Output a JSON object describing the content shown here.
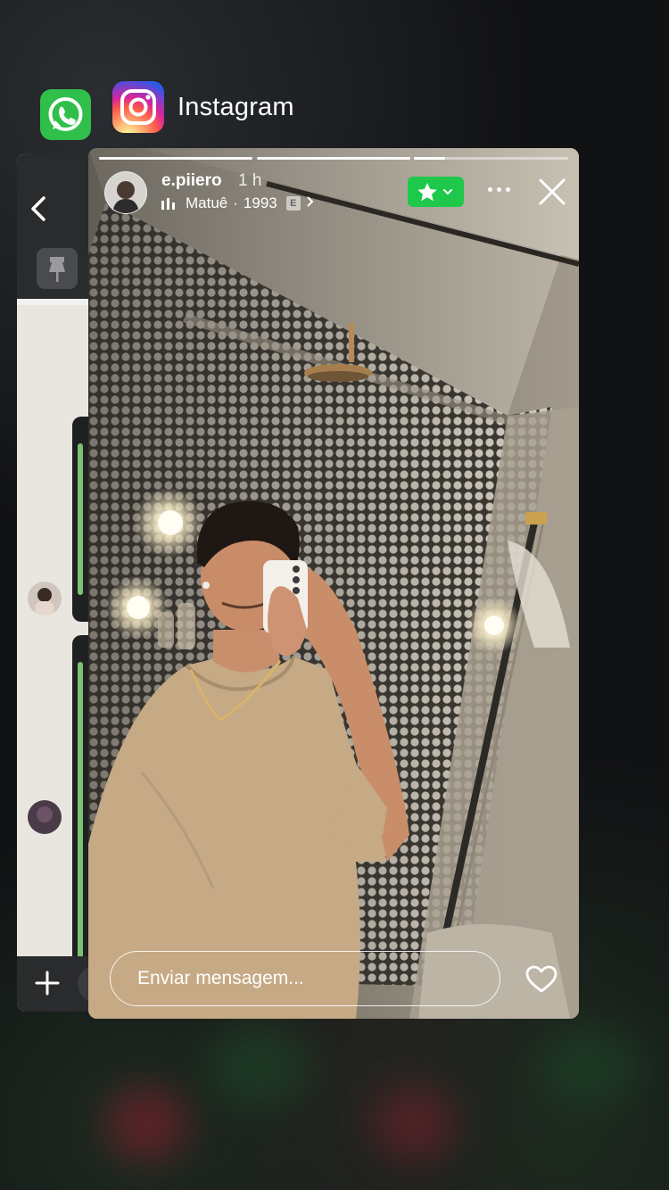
{
  "switcher": {
    "apps": [
      {
        "name": "WhatsApp",
        "icon": "whatsapp-icon"
      },
      {
        "name": "Instagram",
        "icon": "instagram-icon"
      }
    ],
    "active_title": "Instagram"
  },
  "story": {
    "username": "e.piiero",
    "time": "1 h",
    "music": {
      "artist": "Matuê",
      "separator": "·",
      "track": "1993",
      "explicit_badge": "E"
    },
    "close_friends_color": "#1ec84b",
    "message_placeholder": "Enviar mensagem...",
    "progress_segments": 3,
    "active_segment_index": 1
  },
  "colors": {
    "close_friends_green": "#1ec84b",
    "whatsapp_green": "#2fbf4a"
  }
}
